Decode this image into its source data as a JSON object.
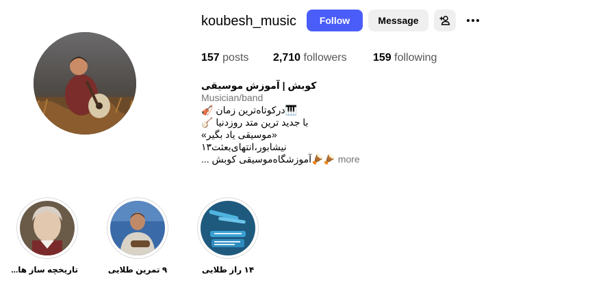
{
  "profile": {
    "username": "koubesh_music",
    "follow_label": "Follow",
    "message_label": "Message",
    "add_user_icon": "person-add-icon",
    "more_icon": "more-horizontal-icon"
  },
  "stats": {
    "posts_count": "157",
    "posts_label": "posts",
    "followers_count": "2,710",
    "followers_label": "followers",
    "following_count": "159",
    "following_label": "following"
  },
  "bio": {
    "name": "کوبش | آموزش موسیقی",
    "category": "Musician/band",
    "lines": [
      "🎹درکوتاه‌ترین زمان 🎻",
      "با جدید ترین متد روزدنیا 🪕",
      "«موسیقی یاد بگیر»",
      "نیشابور،انتهای‌بعثت۱۳",
      "🪘🪘آموزشگاه‌موسیقی کوبش ..."
    ],
    "more_label": "more"
  },
  "highlights": [
    {
      "label": "تاریخچه ساز ها..."
    },
    {
      "label": "۹ تمرین طلایی"
    },
    {
      "label": "۱۴ راز طلایی"
    }
  ],
  "colors": {
    "follow_button": "#4a5df9",
    "secondary_button": "#efefef",
    "muted_text": "#737373"
  }
}
